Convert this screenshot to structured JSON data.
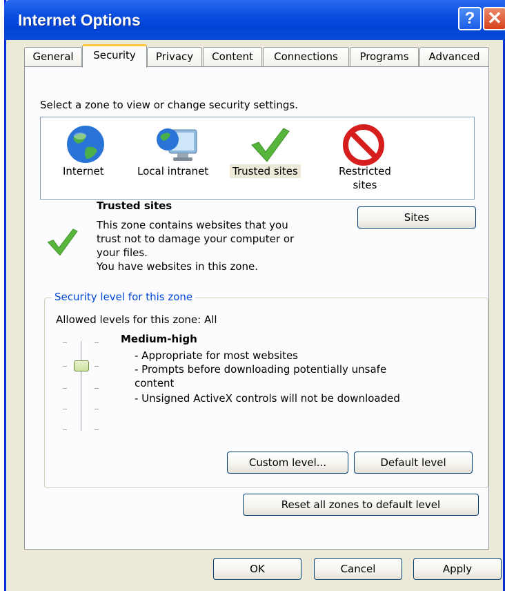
{
  "window": {
    "title": "Internet Options",
    "help_glyph": "?",
    "close_glyph": "✕"
  },
  "tabs": [
    {
      "label": "General"
    },
    {
      "label": "Security"
    },
    {
      "label": "Privacy"
    },
    {
      "label": "Content"
    },
    {
      "label": "Connections"
    },
    {
      "label": "Programs"
    },
    {
      "label": "Advanced"
    }
  ],
  "security": {
    "select_zone_prompt": "Select a zone to view or change security settings.",
    "zones": [
      {
        "label": "Internet",
        "icon": "globe-icon"
      },
      {
        "label": "Local intranet",
        "icon": "monitor-globe-icon"
      },
      {
        "label": "Trusted sites",
        "icon": "checkmark-icon",
        "selected": true
      },
      {
        "label_line1": "Restricted",
        "label_line2": "sites",
        "icon": "no-entry-icon"
      }
    ],
    "zone_info": {
      "title": "Trusted sites",
      "desc_line1": "This zone contains websites that you",
      "desc_line2": "trust not to damage your computer or",
      "desc_line3": "your files.",
      "desc_line4": "You have websites in this zone."
    },
    "sites_button": "Sites",
    "security_level": {
      "group_title": "Security level for this zone",
      "allowed_levels": "Allowed levels for this zone: All",
      "level_name": "Medium-high",
      "bullet1": "- Appropriate for most websites",
      "bullet2a": "- Prompts before downloading potentially unsafe",
      "bullet2b": "content",
      "bullet3": "- Unsigned ActiveX controls will not be downloaded",
      "custom_button": "Custom level...",
      "default_button": "Default level"
    },
    "reset_button": "Reset all zones to default level"
  },
  "footer": {
    "ok": "OK",
    "cancel": "Cancel",
    "apply": "Apply"
  },
  "colors": {
    "title_bar": "#0a4ee0",
    "tab_highlight": "#ffc83c",
    "group_title": "#0046d5",
    "dialog_bg": "#ece9d8"
  }
}
